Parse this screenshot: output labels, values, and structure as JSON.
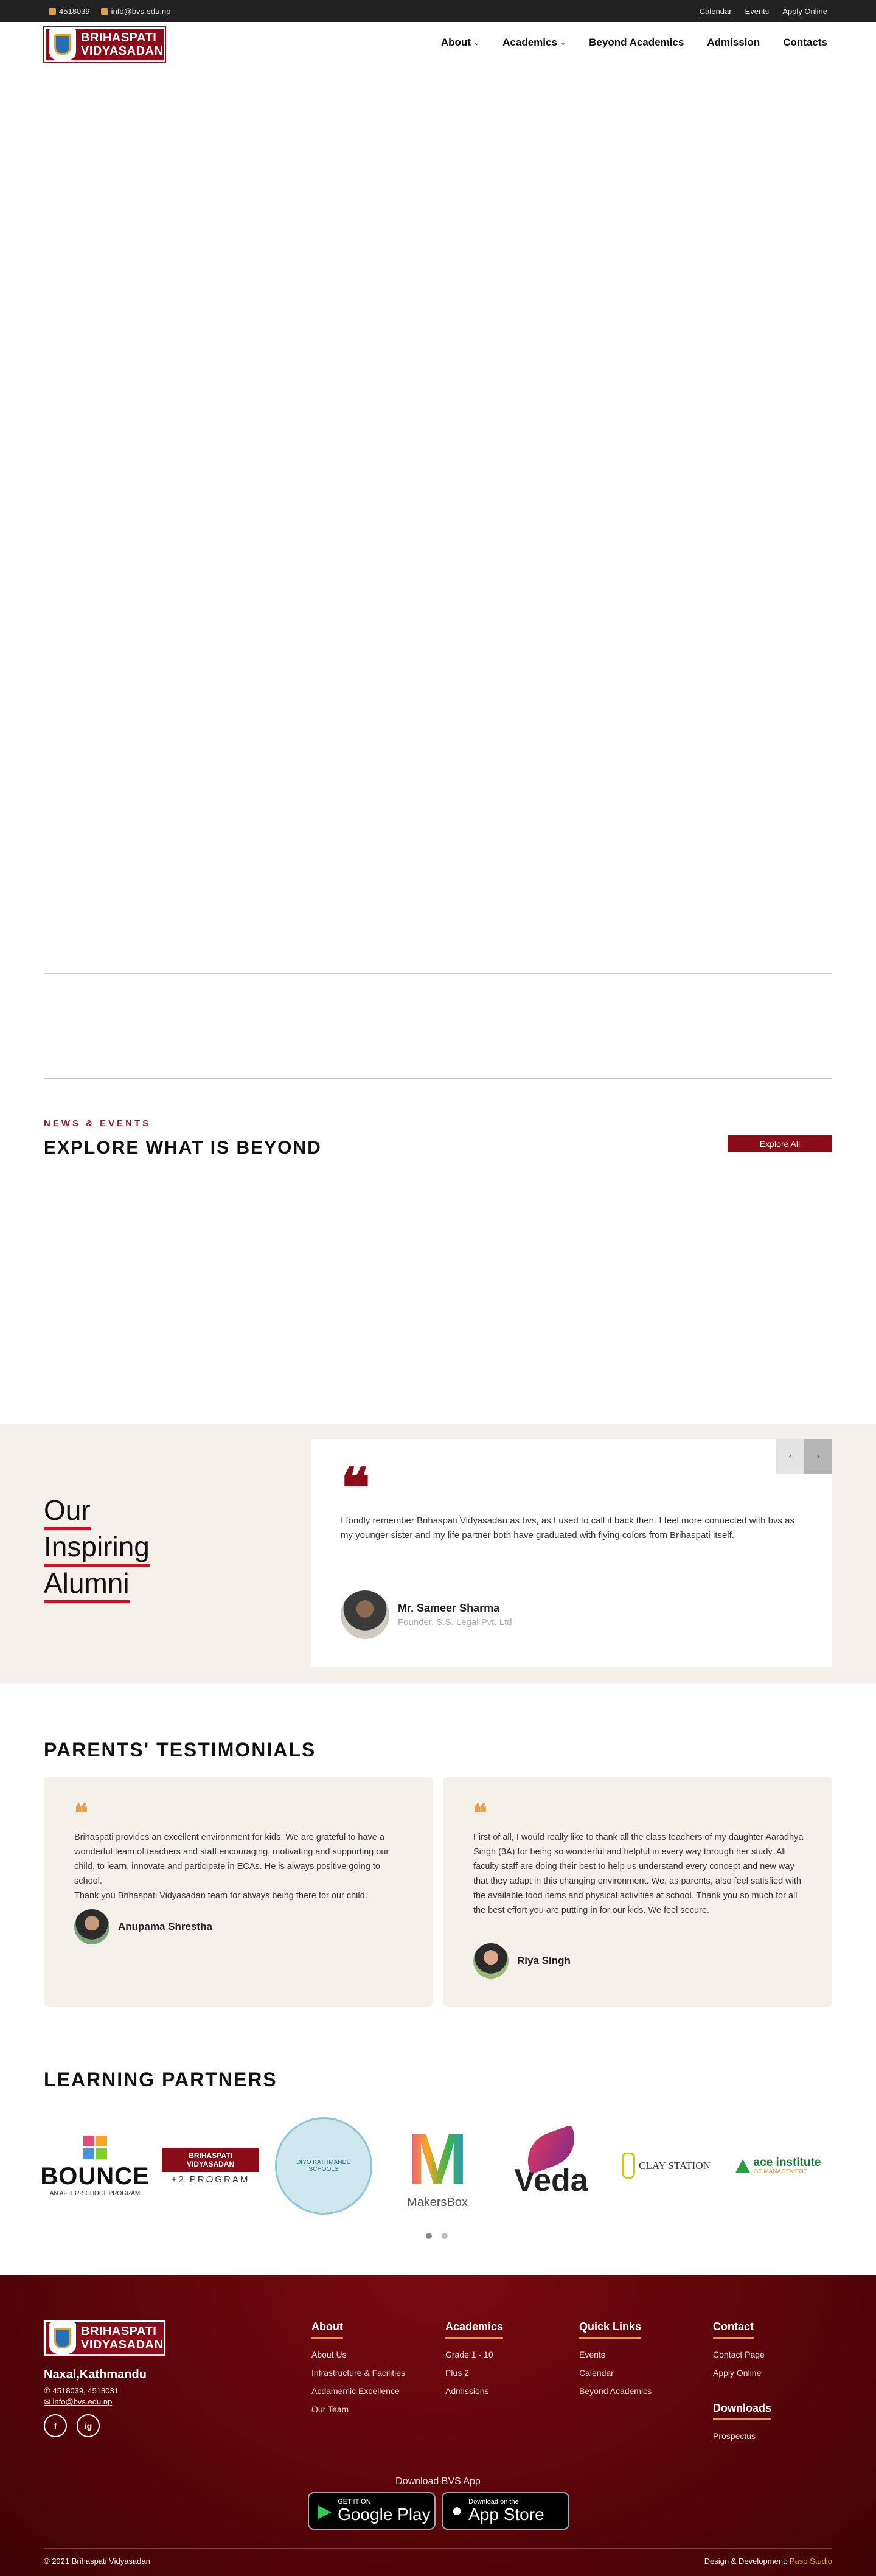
{
  "topbar": {
    "phone": "4518039",
    "email": "info@bvs.edu.np",
    "links": [
      "Calendar",
      "Events",
      "Apply Online"
    ]
  },
  "header": {
    "logo_line1": "BRIHASPATI",
    "logo_line2": "VIDYASADAN",
    "nav": [
      {
        "label": "About",
        "has_dropdown": true
      },
      {
        "label": "Academics",
        "has_dropdown": true
      },
      {
        "label": "Beyond Academics",
        "has_dropdown": false
      },
      {
        "label": "Admission",
        "has_dropdown": false
      },
      {
        "label": "Contacts",
        "has_dropdown": false
      }
    ]
  },
  "news": {
    "kicker": "NEWS & EVENTS",
    "title": "EXPLORE WHAT IS BEYOND",
    "button": "Explore All"
  },
  "alumni": {
    "title_lines": [
      "Our",
      "Inspiring",
      "Alumni"
    ],
    "quote": "I fondly remember Brihaspati Vidyasadan as bvs, as I used to call it back then. I feel more connected with bvs as my younger sister and my life partner both have graduated with flying colors from Brihaspati itself.",
    "name": "Mr. Sameer Sharma",
    "role": "Founder, S.S. Legal Pvt. Ltd",
    "prev": "‹",
    "next": "›"
  },
  "parents": {
    "title": "PARENTS' TESTIMONIALS",
    "cards": [
      {
        "text": "Brihaspati provides an excellent environment for kids. We are grateful to have a wonderful team of teachers and staff encouraging, motivating and supporting our child, to learn, innovate and participate in ECAs. He is always positive going to school.\nThank you Brihaspati Vidyasadan team for always being there for our child.",
        "name": "Anupama Shrestha"
      },
      {
        "text": "First of all, I would really like to thank all the class teachers of my daughter Aaradhya Singh (3A) for being so wonderful and helpful in every way through her study. All faculty staff are doing their best to help us understand every concept and new way that they adapt in this changing environment. We, as parents, also feel satisfied with the available food items and physical activities at school. Thank you so much for all the best effort you are putting in for our kids. We feel secure.",
        "name": "Riya Singh"
      }
    ]
  },
  "partners": {
    "title": "LEARNING PARTNERS",
    "logos": [
      {
        "name": "BOUNCE",
        "sub": "AN AFTER-SCHOOL PROGRAM"
      },
      {
        "name": "BRIHASPATI VIDYASADAN",
        "sub": "+2 PROGRAM"
      },
      {
        "name": "DIYO KATHMANDU SCHOOLS",
        "sub": ""
      },
      {
        "name": "MakersBox",
        "sub": ""
      },
      {
        "name": "Veda",
        "sub": ""
      },
      {
        "name": "CLAY STATION",
        "sub": ""
      },
      {
        "name": "ace institute",
        "sub": "OF MANAGEMENT"
      }
    ]
  },
  "footer": {
    "logo_line1": "BRIHASPATI",
    "logo_line2": "VIDYASADAN",
    "address": "Naxal,Kathmandu",
    "phones": "4518039, 4518031",
    "email": "info@bvs.edu.np",
    "social": [
      "f",
      "ig"
    ],
    "columns": [
      {
        "title": "About",
        "items": [
          "About Us",
          "Infrastructure & Facilities",
          "Acdamemic Excellence",
          "Our Team"
        ]
      },
      {
        "title": "Academics",
        "items": [
          "Grade 1 - 10",
          "Plus 2",
          "Admissions"
        ]
      },
      {
        "title": "Quick Links",
        "items": [
          "Events",
          "Calendar",
          "Beyond Academics"
        ]
      },
      {
        "title": "Contact",
        "items": [
          "Contact Page",
          "Apply Online"
        ]
      },
      {
        "title": "Downloads",
        "items": [
          "Prospectus"
        ]
      }
    ],
    "download_label": "Download BVS App",
    "google": {
      "small": "GET IT ON",
      "big": "Google Play"
    },
    "apple": {
      "small": "Download on the",
      "big": "App Store"
    },
    "copyright": "© 2021 Brihaspati Vidyasadan",
    "design_label": "Design & Development:",
    "design_by": "Paso Studio"
  },
  "colors": {
    "brand": "#8b0d1a",
    "accent": "#e29a2f",
    "beige": "#f4f1ea"
  }
}
